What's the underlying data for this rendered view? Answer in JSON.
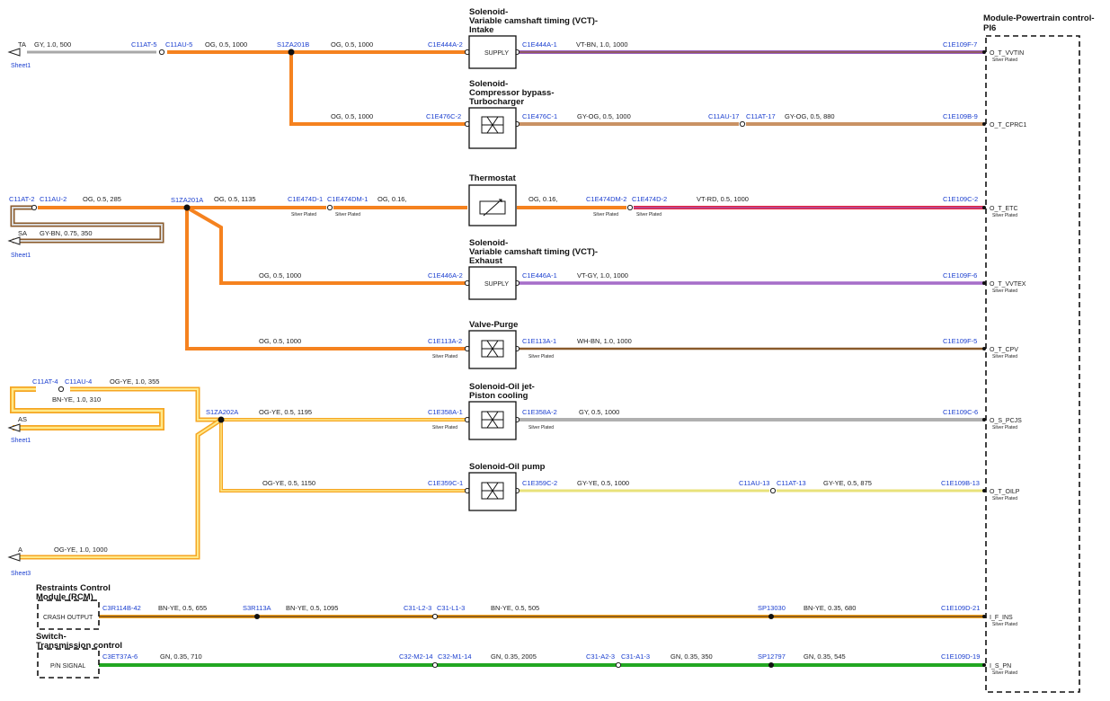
{
  "module": {
    "title_1": "Module-Powertrain control-",
    "title_2": "PI6"
  },
  "pins": [
    "O_T_VVTIN",
    "O_T_CPRC1",
    "O_T_ETC",
    "O_T_VVTEX",
    "O_T_CPV",
    "O_S_PCJS",
    "O_T_OILP",
    "I_F_INS",
    "I_S_PN"
  ],
  "silver": "Silver Plated",
  "components": {
    "vct_intake": [
      "Solenoid-",
      "Variable camshaft timing (VCT)-",
      "Intake"
    ],
    "bypass": [
      "Solenoid-",
      "Compressor bypass-",
      "Turbocharger"
    ],
    "thermostat": [
      "Thermostat"
    ],
    "vct_exhaust": [
      "Solenoid-",
      "Variable camshaft timing (VCT)-",
      "Exhaust"
    ],
    "purge": [
      "Valve-Purge"
    ],
    "oiljet": [
      "Solenoid-Oil jet-",
      "Piston cooling"
    ],
    "oilpump": [
      "Solenoid-Oil pump"
    ],
    "rcm": [
      "Restraints Control",
      "Module (RCM)"
    ],
    "switch": [
      "Switch-",
      "Transmission control"
    ],
    "supply_label": "SUPPLY",
    "crash_output": "CRASH OUTPUT",
    "pn_signal": "P/N SIGNAL"
  },
  "offpage": {
    "ta": "TA",
    "sa": "SA",
    "as": "AS",
    "a": "A",
    "sheet1": "Sheet1",
    "sheet3": "Sheet3"
  },
  "splices": [
    "S1ZA201B",
    "S1ZA201A",
    "S1ZA202A",
    "S3R113A",
    "SP13030",
    "SP12797"
  ],
  "connectors": {
    "c11at5": "C11AT-5",
    "c11au5": "C11AU-5",
    "c1e444a2": "C1E444A-2",
    "c1e444a1": "C1E444A-1",
    "c1e109f7": "C1E109F-7",
    "c1e476c2": "C1E476C-2",
    "c1e476c1": "C1E476C-1",
    "c11au17": "C11AU-17",
    "c11at17": "C11AT-17",
    "c1e109b9": "C1E109B-9",
    "c11at2": "C11AT-2",
    "c11au2": "C11AU-2",
    "c1e474d1": "C1E474D-1",
    "c1e474dm1": "C1E474DM-1",
    "c1e474dm2": "C1E474DM-2",
    "c1e474d2": "C1E474D-2",
    "c1e109c2": "C1E109C-2",
    "c1e446a2": "C1E446A-2",
    "c1e446a1": "C1E446A-1",
    "c1e109f6": "C1E109F-6",
    "c1e113a2": "C1E113A-2",
    "c1e113a1": "C1E113A-1",
    "c1e109f5": "C1E109F-5",
    "c11at4": "C11AT-4",
    "c11au4": "C11AU-4",
    "c1e358a1": "C1E358A-1",
    "c1e358a2": "C1E358A-2",
    "c1e109c6": "C1E109C-6",
    "c1e359c1": "C1E359C-1",
    "c1e359c2": "C1E359C-2",
    "c11au13": "C11AU-13",
    "c11at13": "C11AT-13",
    "c1e109b13": "C1E109B-13",
    "c3r114b42": "C3R114B-42",
    "c31l23": "C31-L2-3",
    "c31l13": "C31-L1-3",
    "c1e109d21": "C1E109D-21",
    "c3et37a6": "C3ET37A-6",
    "c32m214": "C32-M2-14",
    "c32m114": "C32-M1-14",
    "c31a23": "C31-A2-3",
    "c31a13": "C31-A1-3",
    "c1e109d19": "C1E109D-19"
  },
  "wires": {
    "w_ta": "GY, 1.0, 500",
    "w_og05_1000a": "OG, 0.5, 1000",
    "w_og05_1000b": "OG, 0.5, 1000",
    "w_vtbn": "VT-BN, 1.0, 1000",
    "w_og05_1000c": "OG, 0.5, 1000",
    "w_gyog1000": "GY-OG, 0.5, 1000",
    "w_gyog880": "GY-OG, 0.5, 880",
    "w_og285": "OG, 0.5, 285",
    "w_gybn": "GY-BN, 0.75, 350",
    "w_og1135": "OG, 0.5, 1135",
    "w_og016a": "OG, 0.16,",
    "w_og016b": "OG, 0.16,",
    "w_vtrd": "VT-RD, 0.5, 1000",
    "w_og05_1000d": "OG, 0.5, 1000",
    "w_vtgy": "VT-GY, 1.0, 1000",
    "w_og05_1000e": "OG, 0.5, 1000",
    "w_whbn": "WH-BN, 1.0, 1000",
    "w_ogye355": "OG-YE, 1.0, 355",
    "w_bnye310": "BN-YE, 1.0, 310",
    "w_ogye1195": "OG-YE, 0.5, 1195",
    "w_gy1000": "GY, 0.5, 1000",
    "w_ogye1150": "OG-YE, 0.5, 1150",
    "w_gyye1000": "GY-YE, 0.5, 1000",
    "w_gyye875": "GY-YE, 0.5, 875",
    "w_ogye1000": "OG-YE, 1.0, 1000",
    "w_bnye655": "BN-YE, 0.5, 655",
    "w_bnye1095": "BN-YE, 0.5, 1095",
    "w_bnye505": "BN-YE, 0.5, 505",
    "w_bnye680": "BN-YE, 0.35, 680",
    "w_gn710": "GN, 0.35, 710",
    "w_gn2005": "GN, 0.35, 2005",
    "w_gn350": "GN, 0.35, 350",
    "w_gn545": "GN, 0.35, 545"
  },
  "colors": {
    "orange": "#f5821f",
    "grey": "#a8a8a8",
    "violet": "#9b5fc0",
    "brown": "#8a5a2b",
    "red": "#e8213a",
    "yellow": "#ffd21a",
    "green": "#22a722",
    "blue": "#1a3ecf"
  }
}
